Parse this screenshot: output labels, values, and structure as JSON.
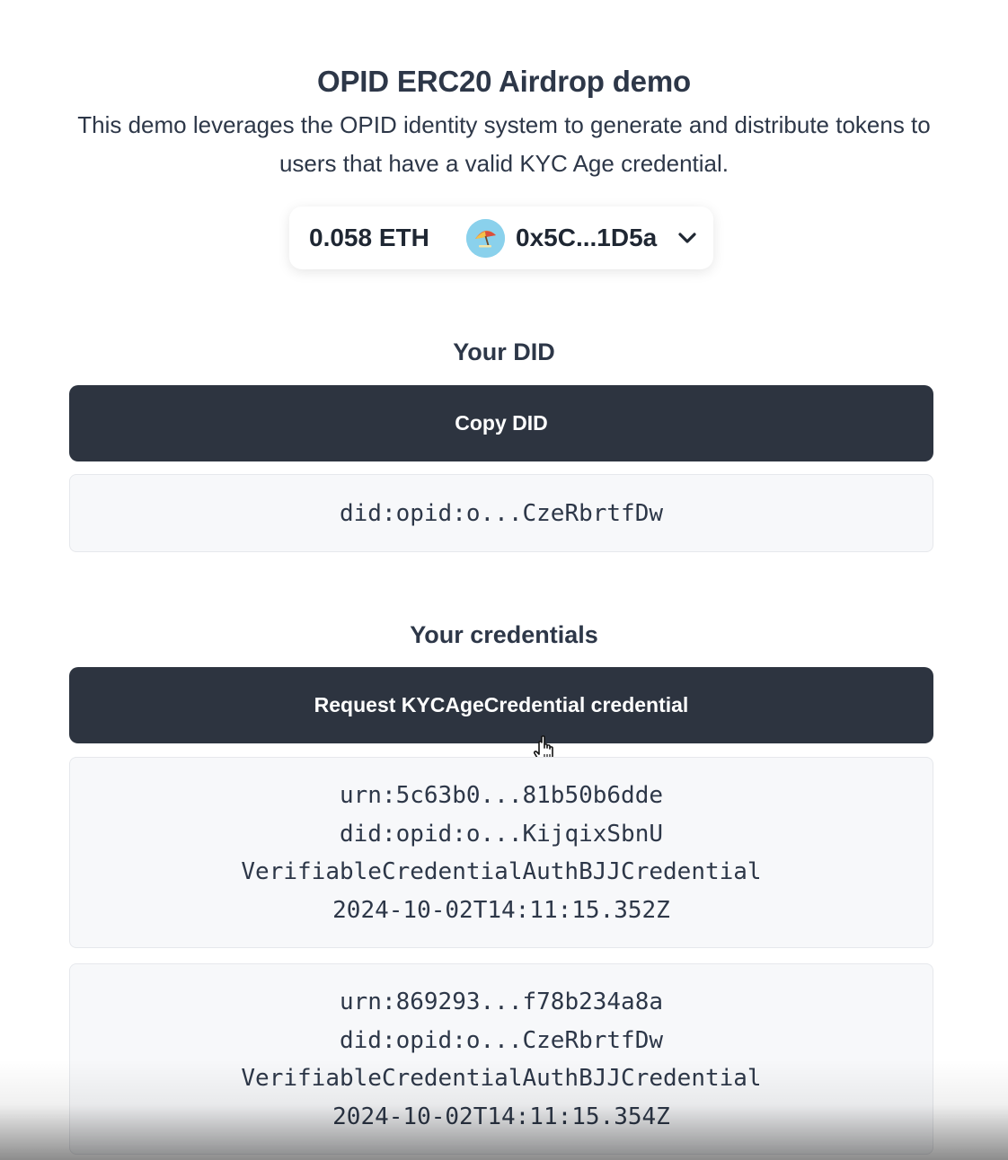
{
  "header": {
    "title": "OPID ERC20 Airdrop demo",
    "subtitle": "This demo leverages the OPID identity system to generate and distribute tokens to users that have a valid KYC Age credential."
  },
  "wallet": {
    "balance": "0.058 ETH",
    "address": "0x5C...1D5a",
    "avatar_icon": "umbrella-avatar-icon",
    "dropdown_icon": "chevron-down-icon"
  },
  "did_section": {
    "heading": "Your DID",
    "copy_button_label": "Copy DID",
    "did_value": "did:opid:o...CzeRbrtfDw"
  },
  "credentials_section": {
    "heading": "Your credentials",
    "request_button_label": "Request KYCAgeCredential credential",
    "credentials": [
      {
        "id": "urn:5c63b0...81b50b6dde",
        "issuer": "did:opid:o...KijqixSbnU",
        "type": "VerifiableCredentialAuthBJJCredential",
        "date": "2024-10-02T14:11:15.352Z"
      },
      {
        "id": "urn:869293...f78b234a8a",
        "issuer": "did:opid:o...CzeRbrtfDw",
        "type": "VerifiableCredentialAuthBJJCredential",
        "date": "2024-10-02T14:11:15.354Z"
      }
    ]
  },
  "colors": {
    "button_bg": "#2d3440",
    "text": "#2d3748",
    "box_bg": "#f7f8fa"
  }
}
